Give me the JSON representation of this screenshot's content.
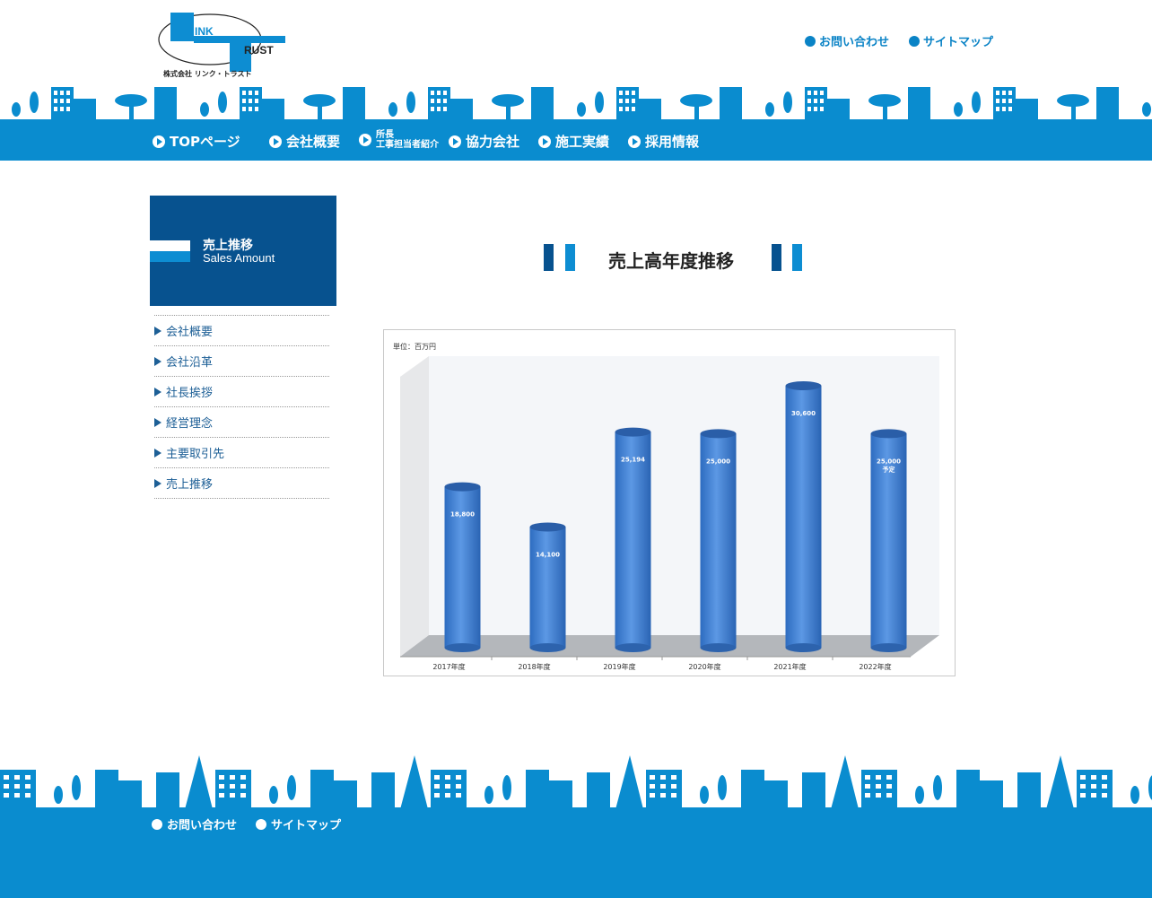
{
  "header": {
    "logo_top": "INK",
    "logo_bottom": "RUST",
    "logo_company": "株式会社 リンク・トラスト",
    "links": [
      "お問い合わせ",
      "サイトマップ"
    ]
  },
  "nav": {
    "items": [
      "TOPページ",
      "会社概要",
      "所長",
      "工事担当者紹介",
      "協力会社",
      "施工実績",
      "採用情報"
    ]
  },
  "sidebar": {
    "title_jp": "売上推移",
    "title_en": "Sales Amount",
    "menu": [
      "会社概要",
      "会社沿革",
      "社長挨拶",
      "経営理念",
      "主要取引先",
      "売上推移"
    ]
  },
  "main": {
    "heading": "売上高年度推移"
  },
  "chart_data": {
    "type": "bar",
    "unit_label": "単位：百万円",
    "categories": [
      "2017年度",
      "2018年度",
      "2019年度",
      "2020年度",
      "2021年度",
      "2022年度"
    ],
    "values": [
      18800,
      14100,
      25194,
      25000,
      30600,
      25000
    ],
    "value_labels": [
      "18,800",
      "14,100",
      "25,194",
      "25,000",
      "30,600",
      "25,000"
    ],
    "value_notes": [
      "",
      "",
      "",
      "",
      "",
      "予定"
    ],
    "ylim": [
      0,
      35000
    ],
    "grid": false,
    "style": "3d-cylinder",
    "bar_color": "#4f8fdc"
  },
  "footer": {
    "links": [
      "お問い合わせ",
      "サイトマップ"
    ]
  },
  "colors": {
    "primary": "#0a8ccf",
    "navy": "#07528f",
    "text_link": "#1d5f96"
  }
}
